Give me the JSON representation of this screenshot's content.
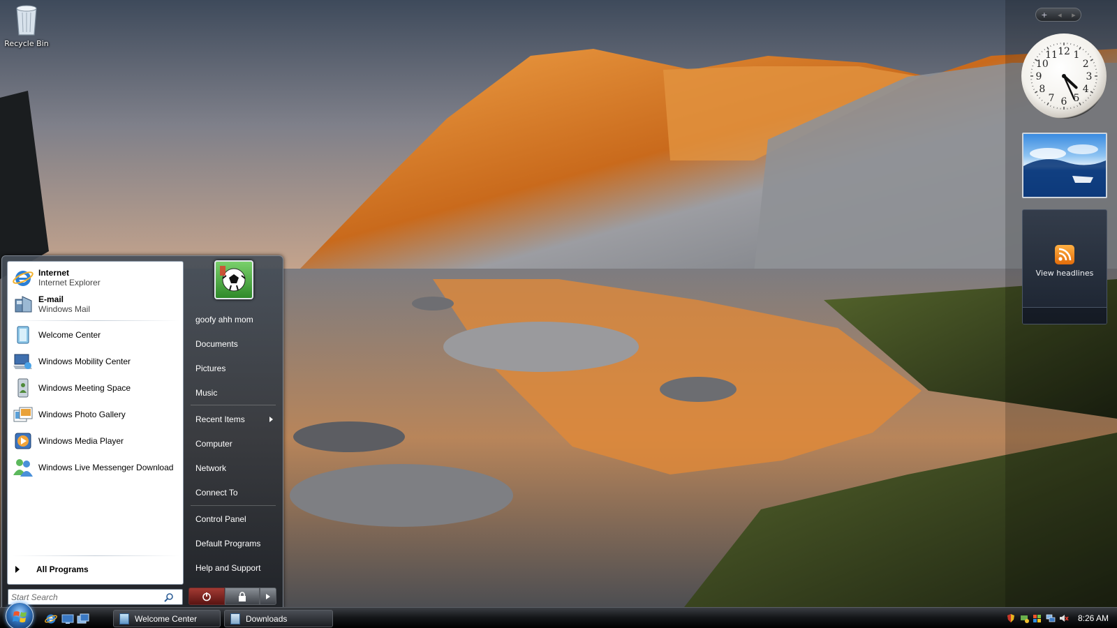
{
  "desktop": {
    "icons": [
      {
        "label": "Recycle Bin",
        "icon": "recycle-bin-icon"
      }
    ]
  },
  "sidebar": {
    "controls": {
      "add": "+",
      "prev": "◂",
      "next": "▸"
    },
    "clock": {
      "numerals": [
        "12",
        "1",
        "2",
        "3",
        "4",
        "5",
        "6",
        "7",
        "8",
        "9",
        "10",
        "11"
      ],
      "hour_hand_time": "4:26",
      "minute": 26
    },
    "slideshow": {
      "icon": "slideshow-image"
    },
    "feed": {
      "label": "View headlines",
      "icon": "rss-icon"
    }
  },
  "start_menu": {
    "pinned": [
      {
        "title": "Internet",
        "subtitle": "Internet Explorer",
        "icon": "internet-explorer-icon"
      },
      {
        "title": "E-mail",
        "subtitle": "Windows Mail",
        "icon": "windows-mail-icon"
      }
    ],
    "recent": [
      {
        "label": "Welcome Center",
        "icon": "welcome-center-icon"
      },
      {
        "label": "Windows Mobility Center",
        "icon": "mobility-center-icon"
      },
      {
        "label": "Windows Meeting Space",
        "icon": "meeting-space-icon"
      },
      {
        "label": "Windows Photo Gallery",
        "icon": "photo-gallery-icon"
      },
      {
        "label": "Windows Media Player",
        "icon": "media-player-icon"
      },
      {
        "label": "Windows Live Messenger Download",
        "icon": "messenger-icon"
      }
    ],
    "all_programs": "All Programs",
    "search_placeholder": "Start Search",
    "user_name": "goofy ahh mom",
    "user_picture": "soccer-ball-avatar",
    "right_items": [
      {
        "label": "Documents"
      },
      {
        "label": "Pictures"
      },
      {
        "label": "Music"
      },
      {
        "label": "Recent Items",
        "submenu": true
      },
      {
        "label": "Computer"
      },
      {
        "label": "Network"
      },
      {
        "label": "Connect To"
      },
      {
        "label": "Control Panel"
      },
      {
        "label": "Default Programs"
      },
      {
        "label": "Help and Support"
      }
    ],
    "power_icons": [
      "power-icon",
      "lock-icon",
      "shutdown-options-arrow-icon"
    ]
  },
  "taskbar": {
    "quick_launch": [
      "internet-explorer-icon",
      "show-desktop-icon",
      "switch-windows-icon"
    ],
    "tasks": [
      {
        "label": "Welcome Center",
        "icon": "welcome-center-icon"
      },
      {
        "label": "Downloads",
        "icon": "folder-icon"
      }
    ],
    "tray_icons": [
      "security-shield-icon",
      "network-status-icon",
      "windows-update-icon",
      "network-icon",
      "volume-muted-icon"
    ],
    "clock": "8:26 AM"
  },
  "colors": {
    "taskbar": "#141619",
    "start_left_pane": "#ffffff",
    "power_button": "#a33a33",
    "accent_glow": "#6ab0ff"
  }
}
